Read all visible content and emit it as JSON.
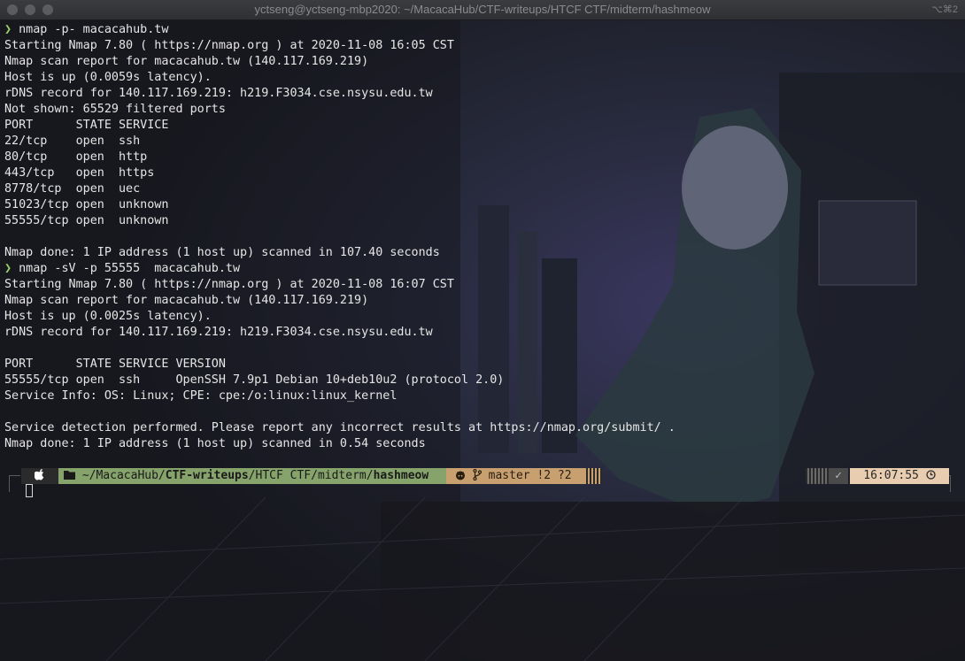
{
  "window": {
    "title": "yctseng@yctseng-mbp2020: ~/MacacaHub/CTF-writeups/HTCF CTF/midterm/hashmeow",
    "shortcut": "⌥⌘2"
  },
  "terminal": {
    "prompt_symbol": "❯",
    "lines": [
      {
        "kind": "cmd",
        "text": "nmap -p- macacahub.tw"
      },
      {
        "kind": "out",
        "text": "Starting Nmap 7.80 ( https://nmap.org ) at 2020-11-08 16:05 CST"
      },
      {
        "kind": "out",
        "text": "Nmap scan report for macacahub.tw (140.117.169.219)"
      },
      {
        "kind": "out",
        "text": "Host is up (0.0059s latency)."
      },
      {
        "kind": "out",
        "text": "rDNS record for 140.117.169.219: h219.F3034.cse.nsysu.edu.tw"
      },
      {
        "kind": "out",
        "text": "Not shown: 65529 filtered ports"
      },
      {
        "kind": "out",
        "text": "PORT      STATE SERVICE"
      },
      {
        "kind": "out",
        "text": "22/tcp    open  ssh"
      },
      {
        "kind": "out",
        "text": "80/tcp    open  http"
      },
      {
        "kind": "out",
        "text": "443/tcp   open  https"
      },
      {
        "kind": "out",
        "text": "8778/tcp  open  uec"
      },
      {
        "kind": "out",
        "text": "51023/tcp open  unknown"
      },
      {
        "kind": "out",
        "text": "55555/tcp open  unknown"
      },
      {
        "kind": "out",
        "text": ""
      },
      {
        "kind": "out",
        "text": "Nmap done: 1 IP address (1 host up) scanned in 107.40 seconds"
      },
      {
        "kind": "cmd",
        "text": "nmap -sV -p 55555  macacahub.tw"
      },
      {
        "kind": "out",
        "text": "Starting Nmap 7.80 ( https://nmap.org ) at 2020-11-08 16:07 CST"
      },
      {
        "kind": "out",
        "text": "Nmap scan report for macacahub.tw (140.117.169.219)"
      },
      {
        "kind": "out",
        "text": "Host is up (0.0025s latency)."
      },
      {
        "kind": "out",
        "text": "rDNS record for 140.117.169.219: h219.F3034.cse.nsysu.edu.tw"
      },
      {
        "kind": "out",
        "text": ""
      },
      {
        "kind": "out",
        "text": "PORT      STATE SERVICE VERSION"
      },
      {
        "kind": "out",
        "text": "55555/tcp open  ssh     OpenSSH 7.9p1 Debian 10+deb10u2 (protocol 2.0)"
      },
      {
        "kind": "out",
        "text": "Service Info: OS: Linux; CPE: cpe:/o:linux:linux_kernel"
      },
      {
        "kind": "out",
        "text": ""
      },
      {
        "kind": "out",
        "text": "Service detection performed. Please report any incorrect results at https://nmap.org/submit/ ."
      },
      {
        "kind": "out",
        "text": "Nmap done: 1 IP address (1 host up) scanned in 0.54 seconds"
      }
    ]
  },
  "prompt": {
    "os_icon": "apple-icon",
    "folder_icon": "folder-icon",
    "path_prefix": "~/MacacaHub/",
    "path_bold1": "CTF-writeups",
    "path_middle": "/HTCF CTF/midterm/",
    "path_bold2": "hashmeow",
    "git_icons": "github-icon, branch-icon",
    "git_branch": "master",
    "git_status": "!2 ?2",
    "status_icon": "check-icon",
    "status_mark": "✓",
    "time": "16:07:55",
    "clock_icon": "clock-icon"
  }
}
